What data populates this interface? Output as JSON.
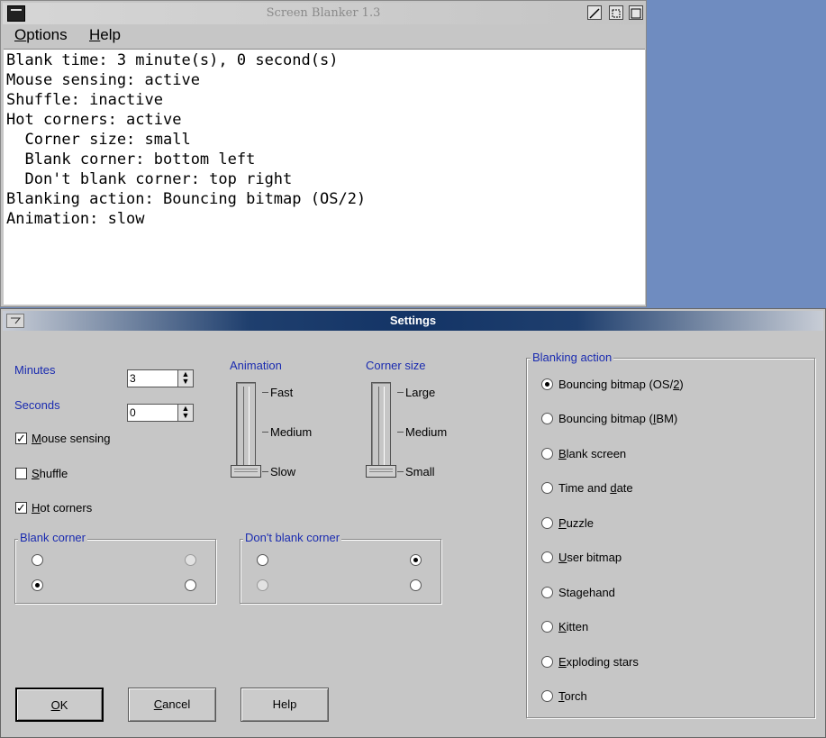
{
  "main_window": {
    "title": "Screen Blanker 1.3",
    "menu": [
      {
        "label": "Options",
        "mnemonic": "O",
        "rest": "ptions"
      },
      {
        "label": "Help",
        "mnemonic": "H",
        "rest": "elp"
      }
    ],
    "lines": [
      "Blank time: 3 minute(s), 0 second(s)",
      "Mouse sensing: active",
      "Shuffle: inactive",
      "Hot corners: active",
      "  Corner size: small",
      "  Blank corner: bottom left",
      "  Don't blank corner: top right",
      "Blanking action: Bouncing bitmap (OS/2)",
      "Animation: slow"
    ]
  },
  "settings": {
    "title": "Settings",
    "minutes_label": "Minutes",
    "minutes_value": "3",
    "seconds_label": "Seconds",
    "seconds_value": "0",
    "mouse_sensing": {
      "pre": "",
      "mn": "M",
      "post": "ouse sensing",
      "checked": true
    },
    "shuffle": {
      "pre": "",
      "mn": "S",
      "post": "huffle",
      "checked": false
    },
    "hot_corners": {
      "pre": "",
      "mn": "H",
      "post": "ot corners",
      "checked": true
    },
    "animation": {
      "label": "Animation",
      "ticks": [
        "Fast",
        "Medium",
        "Slow"
      ],
      "selected": "Slow"
    },
    "corner_size": {
      "label": "Corner size",
      "ticks": [
        "Large",
        "Medium",
        "Small"
      ],
      "selected": "Small"
    },
    "blank_corner": {
      "label": "Blank corner",
      "selected": "bottom-left"
    },
    "dont_blank_corner": {
      "label": "Don't blank corner",
      "selected": "top-right"
    },
    "blanking_action": {
      "label": "Blanking action",
      "options": [
        {
          "pre": "Bouncing bitmap (OS/",
          "mn": "2",
          "post": ")",
          "selected": true
        },
        {
          "pre": "Bouncing bitmap (",
          "mn": "I",
          "post": "BM)",
          "selected": false
        },
        {
          "pre": "",
          "mn": "B",
          "post": "lank screen",
          "selected": false
        },
        {
          "pre": "Time and ",
          "mn": "d",
          "post": "ate",
          "selected": false
        },
        {
          "pre": "",
          "mn": "P",
          "post": "uzzle",
          "selected": false
        },
        {
          "pre": "",
          "mn": "U",
          "post": "ser bitmap",
          "selected": false
        },
        {
          "pre": "Sta",
          "mn": "g",
          "post": "ehand",
          "selected": false
        },
        {
          "pre": "",
          "mn": "K",
          "post": "itten",
          "selected": false
        },
        {
          "pre": "",
          "mn": "E",
          "post": "xploding stars",
          "selected": false
        },
        {
          "pre": "",
          "mn": "T",
          "post": "orch",
          "selected": false
        }
      ]
    },
    "buttons": {
      "ok": {
        "pre": "",
        "mn": "O",
        "post": "K"
      },
      "cancel": {
        "pre": "",
        "mn": "C",
        "post": "ancel"
      },
      "help": {
        "pre": "Help",
        "mn": "",
        "post": ""
      }
    }
  },
  "colors": {
    "desktop": "#6f8cc0",
    "group_label": "#1a2bb0",
    "active_title": "#133466"
  }
}
